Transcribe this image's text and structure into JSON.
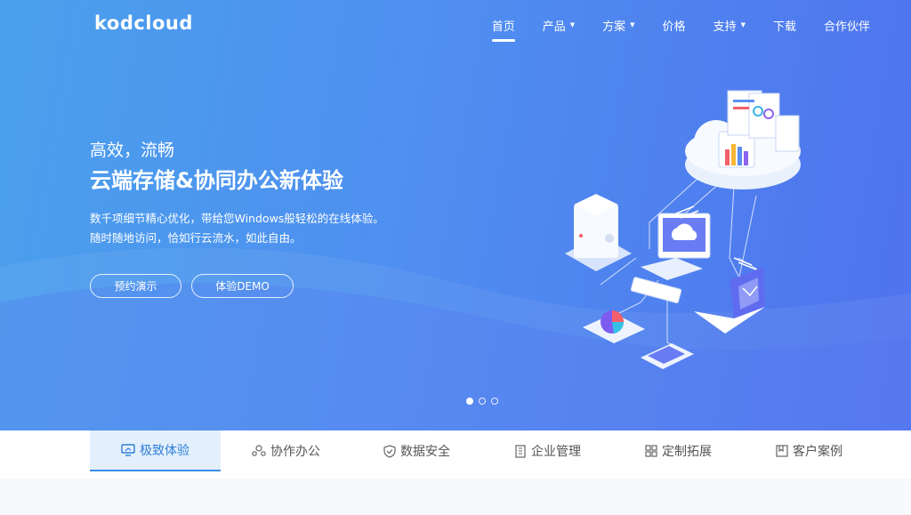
{
  "brand": {
    "logo_text": "kodcloud"
  },
  "nav": {
    "items": [
      {
        "label": "首页",
        "active": true,
        "dropdown": false
      },
      {
        "label": "产品",
        "active": false,
        "dropdown": true
      },
      {
        "label": "方案",
        "active": false,
        "dropdown": true
      },
      {
        "label": "价格",
        "active": false,
        "dropdown": false
      },
      {
        "label": "支持",
        "active": false,
        "dropdown": true
      },
      {
        "label": "下载",
        "active": false,
        "dropdown": false
      },
      {
        "label": "合作伙伴",
        "active": false,
        "dropdown": false
      }
    ]
  },
  "hero": {
    "subtitle": "高效，流畅",
    "title": "云端存储&协同办公新体验",
    "desc_line1": "数千项细节精心优化，带给您Windows般轻松的在线体验。",
    "desc_line2": "随时随地访问，恰如行云流水，如此自由。",
    "button_1": "预约演示",
    "button_2": "体验DEMO",
    "carousel_active_index": 0,
    "carousel_count": 3
  },
  "feature_tabs": [
    {
      "label": "极致体验",
      "icon": "monitor-icon",
      "active": true
    },
    {
      "label": "协作办公",
      "icon": "team-icon",
      "active": false
    },
    {
      "label": "数据安全",
      "icon": "shield-icon",
      "active": false
    },
    {
      "label": "企业管理",
      "icon": "building-icon",
      "active": false
    },
    {
      "label": "定制拓展",
      "icon": "apps-icon",
      "active": false
    },
    {
      "label": "客户案例",
      "icon": "bookmark-icon",
      "active": false
    }
  ],
  "colors": {
    "hero_start": "#4aa0ec",
    "hero_end": "#4f72ee",
    "accent": "#2f7fd6",
    "active_tab_bg": "#e3f0fc"
  }
}
